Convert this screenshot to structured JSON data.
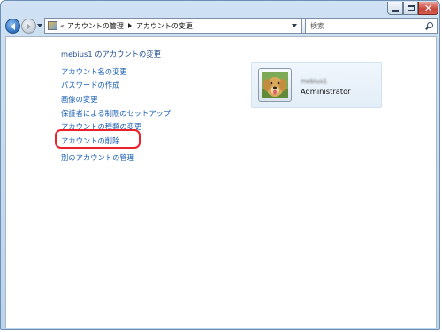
{
  "breadcrumb": {
    "item1": "アカウントの管理",
    "item2": "アカウントの変更"
  },
  "search": {
    "placeholder": "検索"
  },
  "heading": "mebius1 のアカウントの変更",
  "links": [
    "アカウント名の変更",
    "パスワードの作成",
    "画像の変更",
    "保護者による制限のセットアップ",
    "アカウントの種類の変更",
    "アカウントの削除",
    "別のアカウントの管理"
  ],
  "user": {
    "name": "mebius1",
    "role": "Administrator"
  },
  "highlight_color": "#e8212a",
  "link_color": "#1a5fb4"
}
